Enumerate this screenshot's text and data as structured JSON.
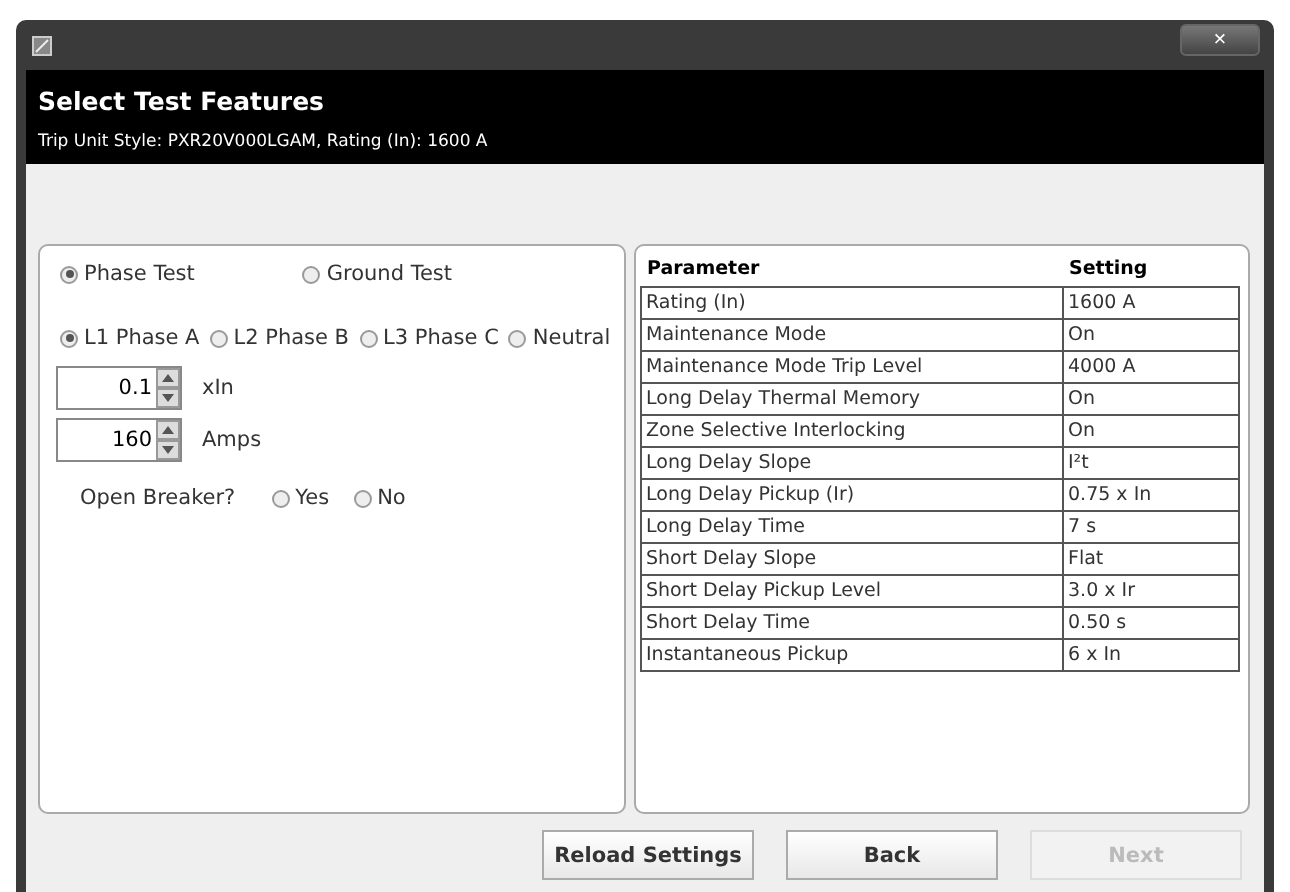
{
  "window": {
    "close": "×"
  },
  "header": {
    "title": "Select Test Features",
    "subtitle": "Trip Unit Style: PXR20V000LGAM, Rating (In): 1600 A"
  },
  "test_type": [
    {
      "label": "Phase Test",
      "selected": true
    },
    {
      "label": "Ground Test",
      "selected": false
    }
  ],
  "phases": [
    {
      "label": "L1 Phase A",
      "selected": true
    },
    {
      "label": "L2 Phase B",
      "selected": false
    },
    {
      "label": "L3 Phase C",
      "selected": false
    },
    {
      "label": "Neutral",
      "selected": false
    }
  ],
  "spinners": [
    {
      "value": "0.1",
      "unit": "xIn"
    },
    {
      "value": "160",
      "unit": "Amps"
    }
  ],
  "open_breaker": {
    "label": "Open Breaker?",
    "options": [
      {
        "label": "Yes",
        "selected": false
      },
      {
        "label": "No",
        "selected": false
      }
    ]
  },
  "table": {
    "columns": [
      "Parameter",
      "Setting"
    ],
    "rows": [
      [
        "Rating (In)",
        "1600 A"
      ],
      [
        "Maintenance Mode",
        "On"
      ],
      [
        "Maintenance Mode Trip Level",
        "4000 A"
      ],
      [
        "Long Delay Thermal Memory",
        "On"
      ],
      [
        "Zone Selective Interlocking",
        "On"
      ],
      [
        "Long Delay Slope",
        "I²t"
      ],
      [
        "Long Delay Pickup (Ir)",
        "0.75 x In"
      ],
      [
        "Long Delay Time",
        "7 s"
      ],
      [
        "Short Delay Slope",
        "Flat"
      ],
      [
        "Short Delay Pickup Level",
        "3.0 x Ir"
      ],
      [
        "Short Delay Time",
        "0.50 s"
      ],
      [
        "Instantaneous Pickup",
        "6 x In"
      ]
    ]
  },
  "buttons": [
    {
      "label": "Reload Settings",
      "disabled": false
    },
    {
      "label": "Back",
      "disabled": false
    },
    {
      "label": "Next",
      "disabled": true
    }
  ]
}
